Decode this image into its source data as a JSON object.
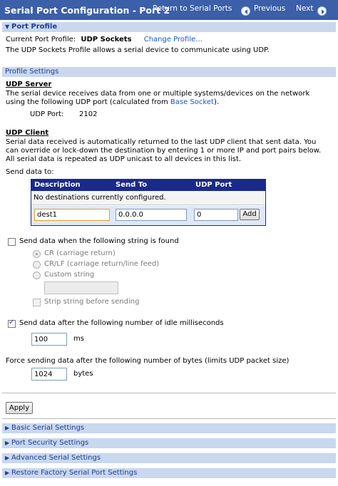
{
  "header": {
    "title": "Serial Port Configuration - Port 2",
    "return_link": "Return to Serial Ports",
    "previous_label": "Previous",
    "next_label": "Next"
  },
  "port_profile": {
    "section_label": "Port Profile",
    "current_label": "Current Port Profile:",
    "current_value": "UDP Sockets",
    "change_link": "Change Profile...",
    "description": "The UDP Sockets Profile allows a serial device to communicate using UDP."
  },
  "profile_settings": {
    "section_label": "Profile Settings",
    "udp_server": {
      "heading": "UDP Server",
      "desc_line1": "The serial device receives data from one or multiple systems/devices on the network",
      "desc_line2_prefix": "using the following UDP port (calculated from ",
      "base_socket_link": "Base Socket",
      "desc_line2_suffix": ").",
      "port_label": "UDP Port:",
      "port_value": "2102"
    },
    "udp_client": {
      "heading": "UDP Client",
      "desc_line1": "Serial data received is automatically returned to the last UDP client that sent data. You",
      "desc_line2": "can override or lock-down the destination by entering 1 or more IP and port pairs below.",
      "desc_line3": "All serial data is repeated as UDP unicast to all devices in this list.",
      "send_to_label": "Send data to:",
      "table": {
        "columns": [
          "Description",
          "Send To",
          "UDP Port"
        ],
        "empty_message": "No destinations currently configured.",
        "description_value": "dest1",
        "send_to_value": "0.0.0.0",
        "udp_port_value": "0",
        "add_label": "Add"
      }
    },
    "string_trigger": {
      "label": "Send data when the following string is found",
      "checked": false,
      "options": [
        "CR (carriage return)",
        "CR/LF (carriage return/line feed)",
        "Custom string"
      ],
      "selected": "CR (carriage return)",
      "custom_value": "",
      "strip_label": "Strip string before sending"
    },
    "idle_trigger": {
      "label": "Send data after the following number of idle milliseconds",
      "checked": true,
      "value": "100",
      "unit": "ms"
    },
    "force_send": {
      "label": "Force sending data after the following number of bytes (limits UDP packet size)",
      "value": "1024",
      "unit": "bytes"
    },
    "apply_label": "Apply"
  },
  "collapsed_sections": [
    "Basic Serial Settings",
    "Port Security Settings",
    "Advanced Serial Settings",
    "Restore Factory Serial Port Settings"
  ],
  "colors": {
    "title_bar": "#3b5fa8",
    "section_bar": "#c9d7ef",
    "link": "#1a56c8",
    "table_header": "#1a2a8a"
  }
}
